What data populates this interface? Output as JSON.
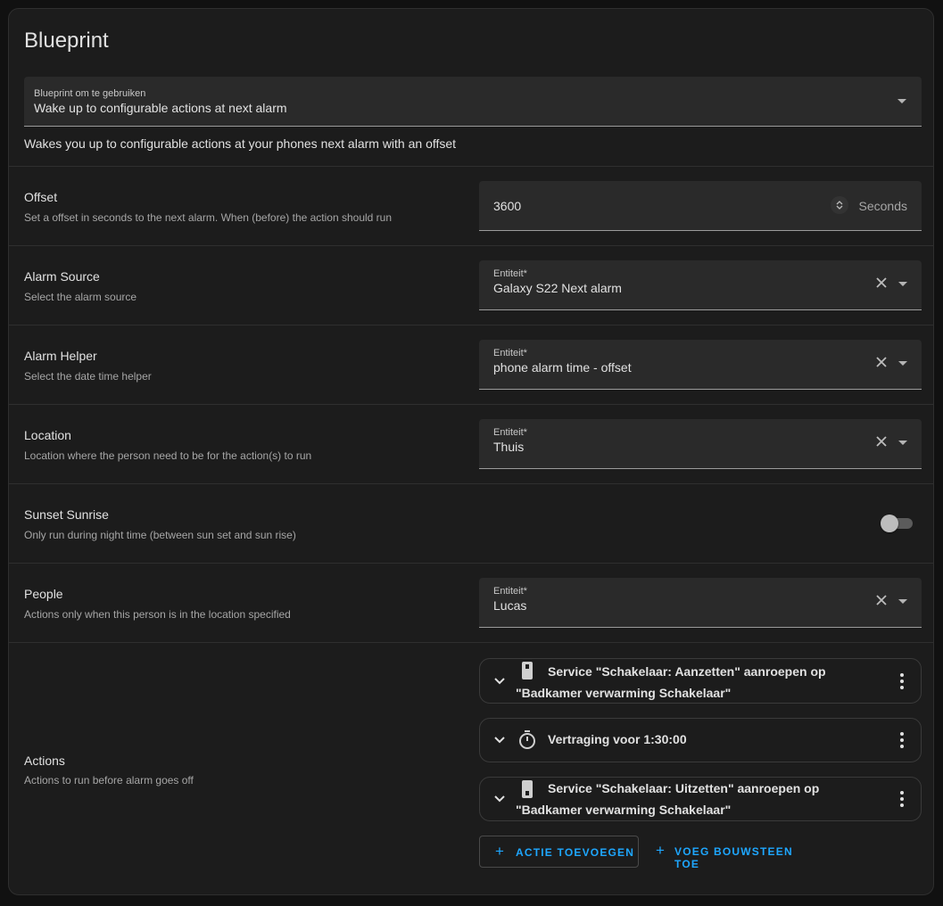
{
  "card": {
    "title": "Blueprint",
    "blueprint_select": {
      "label": "Blueprint om te gebruiken",
      "value": "Wake up to configurable actions at next alarm"
    },
    "description": "Wakes you up to configurable actions at your phones next alarm with an offset"
  },
  "inputs": {
    "offset": {
      "name": "Offset",
      "description": "Set a offset in seconds to the next alarm. When (before) the action should run",
      "value": "3600",
      "unit": "Seconds"
    },
    "alarm_source": {
      "name": "Alarm Source",
      "description": "Select the alarm source",
      "field_label": "Entiteit*",
      "value": "Galaxy S22 Next alarm"
    },
    "alarm_helper": {
      "name": "Alarm Helper",
      "description": "Select the date time helper",
      "field_label": "Entiteit*",
      "value": "phone alarm time - offset"
    },
    "location": {
      "name": "Location",
      "description": "Location where the person need to be for the action(s) to run",
      "field_label": "Entiteit*",
      "value": "Thuis"
    },
    "sunset_sunrise": {
      "name": "Sunset Sunrise",
      "description": "Only run during night time (between sun set and sun rise)",
      "enabled": false
    },
    "people": {
      "name": "People",
      "description": "Actions only when this person is in the location specified",
      "field_label": "Entiteit*",
      "value": "Lucas"
    },
    "actions": {
      "name": "Actions",
      "description": "Actions to run before alarm goes off",
      "items": [
        {
          "icon": "switch-icon",
          "text": "Service \"Schakelaar: Aanzetten\" aanroepen op \"Badkamer verwarming Schakelaar\""
        },
        {
          "icon": "timer-icon",
          "text": "Vertraging voor 1:30:00"
        },
        {
          "icon": "switch-icon",
          "text": "Service \"Schakelaar: Uitzetten\" aanroepen op \"Badkamer verwarming Schakelaar\""
        }
      ],
      "add_action_label": "ACTIE TOEVOEGEN",
      "add_block_label": "VOEG BOUWSTEEN TOE"
    }
  },
  "colors": {
    "accent": "#1ea7ff",
    "card_bg": "#1c1c1c",
    "field_bg": "#2a2a2a"
  }
}
